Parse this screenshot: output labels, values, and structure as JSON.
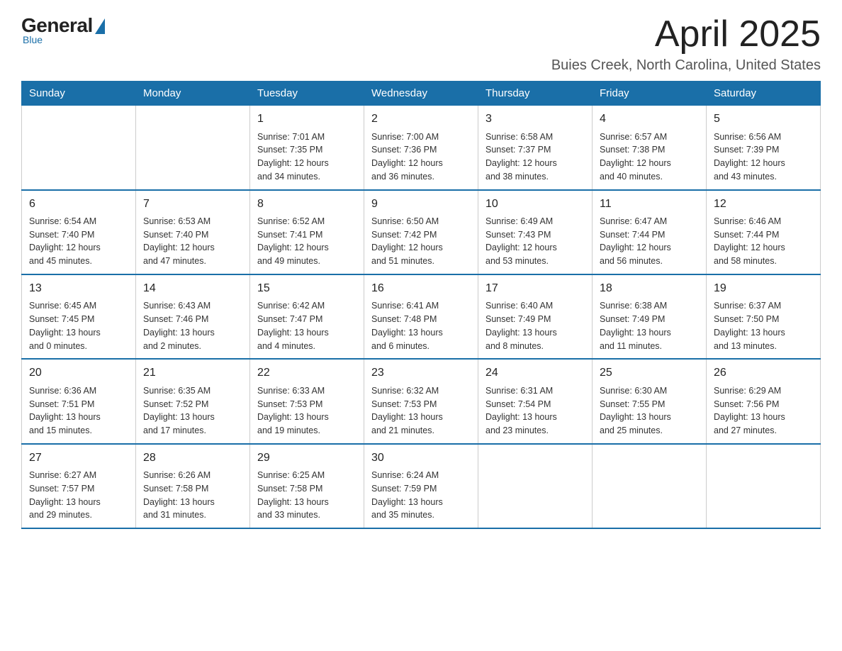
{
  "logo": {
    "general": "General",
    "blue": "Blue",
    "subtitle": "Blue"
  },
  "header": {
    "month": "April 2025",
    "location": "Buies Creek, North Carolina, United States"
  },
  "days_of_week": [
    "Sunday",
    "Monday",
    "Tuesday",
    "Wednesday",
    "Thursday",
    "Friday",
    "Saturday"
  ],
  "weeks": [
    [
      {
        "day": "",
        "info": ""
      },
      {
        "day": "",
        "info": ""
      },
      {
        "day": "1",
        "info": "Sunrise: 7:01 AM\nSunset: 7:35 PM\nDaylight: 12 hours\nand 34 minutes."
      },
      {
        "day": "2",
        "info": "Sunrise: 7:00 AM\nSunset: 7:36 PM\nDaylight: 12 hours\nand 36 minutes."
      },
      {
        "day": "3",
        "info": "Sunrise: 6:58 AM\nSunset: 7:37 PM\nDaylight: 12 hours\nand 38 minutes."
      },
      {
        "day": "4",
        "info": "Sunrise: 6:57 AM\nSunset: 7:38 PM\nDaylight: 12 hours\nand 40 minutes."
      },
      {
        "day": "5",
        "info": "Sunrise: 6:56 AM\nSunset: 7:39 PM\nDaylight: 12 hours\nand 43 minutes."
      }
    ],
    [
      {
        "day": "6",
        "info": "Sunrise: 6:54 AM\nSunset: 7:40 PM\nDaylight: 12 hours\nand 45 minutes."
      },
      {
        "day": "7",
        "info": "Sunrise: 6:53 AM\nSunset: 7:40 PM\nDaylight: 12 hours\nand 47 minutes."
      },
      {
        "day": "8",
        "info": "Sunrise: 6:52 AM\nSunset: 7:41 PM\nDaylight: 12 hours\nand 49 minutes."
      },
      {
        "day": "9",
        "info": "Sunrise: 6:50 AM\nSunset: 7:42 PM\nDaylight: 12 hours\nand 51 minutes."
      },
      {
        "day": "10",
        "info": "Sunrise: 6:49 AM\nSunset: 7:43 PM\nDaylight: 12 hours\nand 53 minutes."
      },
      {
        "day": "11",
        "info": "Sunrise: 6:47 AM\nSunset: 7:44 PM\nDaylight: 12 hours\nand 56 minutes."
      },
      {
        "day": "12",
        "info": "Sunrise: 6:46 AM\nSunset: 7:44 PM\nDaylight: 12 hours\nand 58 minutes."
      }
    ],
    [
      {
        "day": "13",
        "info": "Sunrise: 6:45 AM\nSunset: 7:45 PM\nDaylight: 13 hours\nand 0 minutes."
      },
      {
        "day": "14",
        "info": "Sunrise: 6:43 AM\nSunset: 7:46 PM\nDaylight: 13 hours\nand 2 minutes."
      },
      {
        "day": "15",
        "info": "Sunrise: 6:42 AM\nSunset: 7:47 PM\nDaylight: 13 hours\nand 4 minutes."
      },
      {
        "day": "16",
        "info": "Sunrise: 6:41 AM\nSunset: 7:48 PM\nDaylight: 13 hours\nand 6 minutes."
      },
      {
        "day": "17",
        "info": "Sunrise: 6:40 AM\nSunset: 7:49 PM\nDaylight: 13 hours\nand 8 minutes."
      },
      {
        "day": "18",
        "info": "Sunrise: 6:38 AM\nSunset: 7:49 PM\nDaylight: 13 hours\nand 11 minutes."
      },
      {
        "day": "19",
        "info": "Sunrise: 6:37 AM\nSunset: 7:50 PM\nDaylight: 13 hours\nand 13 minutes."
      }
    ],
    [
      {
        "day": "20",
        "info": "Sunrise: 6:36 AM\nSunset: 7:51 PM\nDaylight: 13 hours\nand 15 minutes."
      },
      {
        "day": "21",
        "info": "Sunrise: 6:35 AM\nSunset: 7:52 PM\nDaylight: 13 hours\nand 17 minutes."
      },
      {
        "day": "22",
        "info": "Sunrise: 6:33 AM\nSunset: 7:53 PM\nDaylight: 13 hours\nand 19 minutes."
      },
      {
        "day": "23",
        "info": "Sunrise: 6:32 AM\nSunset: 7:53 PM\nDaylight: 13 hours\nand 21 minutes."
      },
      {
        "day": "24",
        "info": "Sunrise: 6:31 AM\nSunset: 7:54 PM\nDaylight: 13 hours\nand 23 minutes."
      },
      {
        "day": "25",
        "info": "Sunrise: 6:30 AM\nSunset: 7:55 PM\nDaylight: 13 hours\nand 25 minutes."
      },
      {
        "day": "26",
        "info": "Sunrise: 6:29 AM\nSunset: 7:56 PM\nDaylight: 13 hours\nand 27 minutes."
      }
    ],
    [
      {
        "day": "27",
        "info": "Sunrise: 6:27 AM\nSunset: 7:57 PM\nDaylight: 13 hours\nand 29 minutes."
      },
      {
        "day": "28",
        "info": "Sunrise: 6:26 AM\nSunset: 7:58 PM\nDaylight: 13 hours\nand 31 minutes."
      },
      {
        "day": "29",
        "info": "Sunrise: 6:25 AM\nSunset: 7:58 PM\nDaylight: 13 hours\nand 33 minutes."
      },
      {
        "day": "30",
        "info": "Sunrise: 6:24 AM\nSunset: 7:59 PM\nDaylight: 13 hours\nand 35 minutes."
      },
      {
        "day": "",
        "info": ""
      },
      {
        "day": "",
        "info": ""
      },
      {
        "day": "",
        "info": ""
      }
    ]
  ]
}
